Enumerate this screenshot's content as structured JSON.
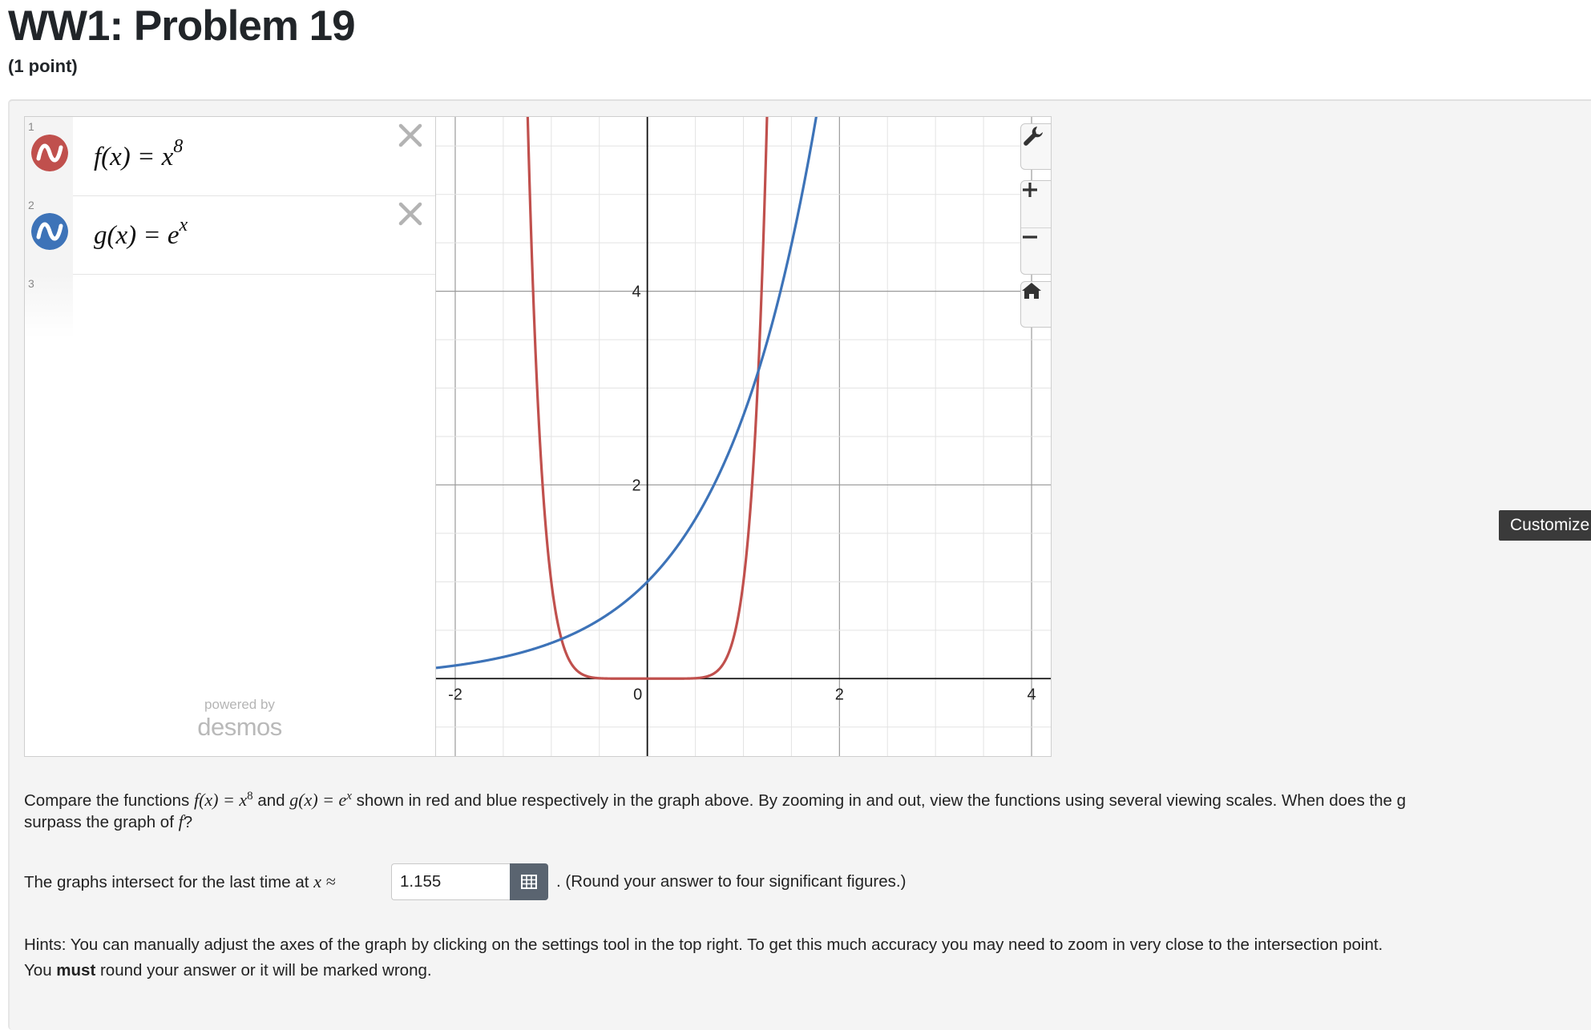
{
  "page": {
    "title": "WW1: Problem 19",
    "points": "(1 point)"
  },
  "calculator": {
    "expressions": [
      {
        "index": "1",
        "latex_lhs": "f(x) = x",
        "exponent": "8",
        "color": "#c0504d"
      },
      {
        "index": "2",
        "latex_lhs": "g(x) = e",
        "exponent": "x",
        "color": "#3d73b8"
      },
      {
        "index": "3"
      }
    ],
    "powered_by": "powered by",
    "brand": "desmos",
    "tools": {
      "settings_icon": "wrench-icon",
      "zoom_in_icon": "plus-icon",
      "zoom_out_icon": "minus-icon",
      "home_icon": "home-icon"
    },
    "axis_tick_labels": {
      "x": [
        "-2",
        "0",
        "2",
        "4"
      ],
      "y": [
        "2",
        "4"
      ]
    }
  },
  "chart_data": {
    "type": "line",
    "xlim": [
      -2.2,
      4.2
    ],
    "ylim": [
      -0.8,
      5.8
    ],
    "grid": true,
    "series": [
      {
        "name": "f(x) = x^8",
        "function": "x^8",
        "color": "#c0504d"
      },
      {
        "name": "g(x) = e^x",
        "function": "e^x",
        "color": "#3d73b8"
      }
    ],
    "x_ticks": [
      -2,
      0,
      2,
      4
    ],
    "y_ticks": [
      2,
      4
    ]
  },
  "customize_label": "Customize",
  "question": {
    "part1": "Compare the functions",
    "f_expr": "f(x) = x",
    "f_exp": "8",
    "and": "and",
    "g_expr": "g(x) = e",
    "g_exp": "x",
    "part2": "shown in red and blue respectively in the graph above. By zooming in and out, view the functions using several viewing scales. When does the g",
    "line2a": "surpass the graph of",
    "line2_f": "f",
    "line2b": "?"
  },
  "answer": {
    "prefix": "The graphs intersect for the last time at",
    "prefix_math": "x ≈",
    "value": "1.155",
    "suffix": ". (Round your answer to four significant figures.)",
    "button_icon": "grid-icon"
  },
  "hints": {
    "line1": "Hints: You can manually adjust the axes of the graph by clicking on the settings tool in the top right. To get this much accuracy you may need to zoom in very close to the intersection point.",
    "line2_pre": "You",
    "line2_bold": "must",
    "line2_post": "round your answer or it will be marked wrong."
  }
}
